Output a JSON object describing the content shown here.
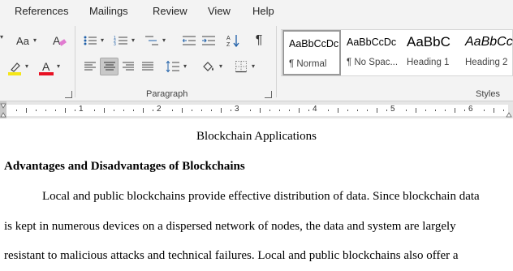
{
  "menu": {
    "tabs": [
      "References",
      "Mailings",
      "Review",
      "View",
      "Help"
    ]
  },
  "ribbon": {
    "font_group": {
      "change_case_label": "Aa",
      "highlight_color": "#f5e617",
      "font_color": "#e81123"
    },
    "paragraph_group": {
      "label": "Paragraph",
      "sort_icon_label": "A Z",
      "pilcrow_label": "¶"
    },
    "styles_group": {
      "label": "Styles",
      "styles": [
        {
          "preview": "AaBbCcDc",
          "name": "¶ Normal"
        },
        {
          "preview": "AaBbCcDc",
          "name": "¶ No Spac..."
        },
        {
          "preview": "AaBbC",
          "name": "Heading 1"
        },
        {
          "preview": "AaBbCc",
          "name": "Heading 2"
        }
      ]
    }
  },
  "ruler": {
    "numbers": [
      "1",
      "2",
      "3",
      "4",
      "5",
      "6"
    ]
  },
  "document": {
    "title": "Blockchain Applications",
    "heading": "Advantages and Disadvantages of Blockchains",
    "lines": [
      "Local and public blockchains provide effective distribution of data. Since blockchain data",
      "is kept in numerous devices on a dispersed network of nodes, the data and system are largely",
      "resistant to malicious attacks and technical failures. Local and public blockchains also offer a"
    ]
  }
}
